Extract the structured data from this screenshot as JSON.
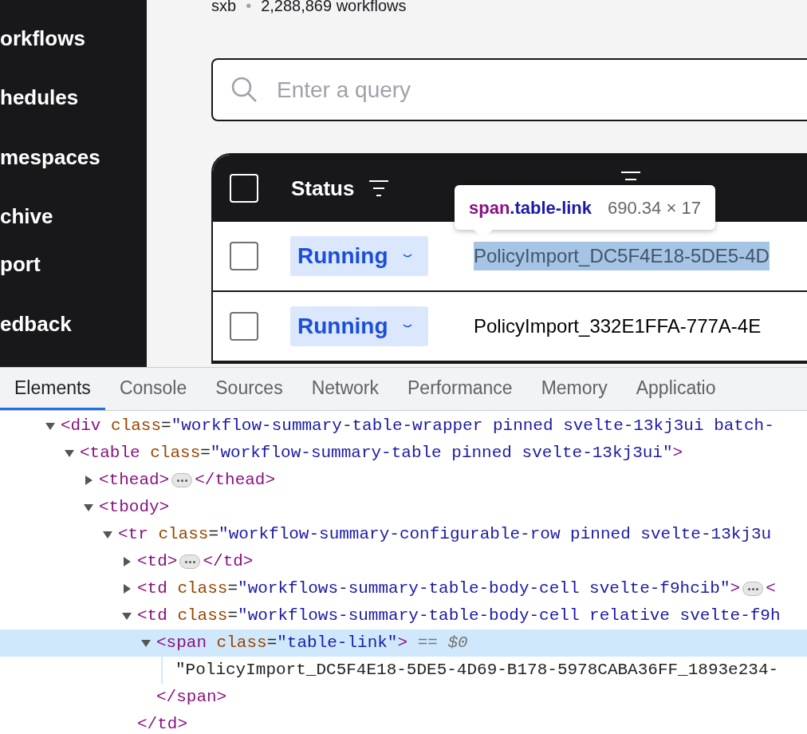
{
  "sidebar": {
    "items": [
      {
        "label": "orkflows"
      },
      {
        "label": "hedules"
      },
      {
        "label": "mespaces"
      },
      {
        "label": "chive"
      },
      {
        "label": "port"
      },
      {
        "label": "edback"
      }
    ]
  },
  "header": {
    "namespace": "sxb",
    "separator": "•",
    "count": "2,288,869 workflows"
  },
  "search": {
    "placeholder": "Enter a query"
  },
  "table": {
    "header": {
      "checked": false,
      "columns": [
        {
          "label": "Status",
          "filter": true
        },
        {
          "filter": true
        }
      ]
    },
    "rows": [
      {
        "checked": false,
        "status": "Running",
        "workflow_id": "PolicyImport_DC5F4E18-5DE5-4D",
        "inspected": true
      },
      {
        "checked": false,
        "status": "Running",
        "workflow_id": "PolicyImport_332E1FFA-777A-4E",
        "inspected": false
      }
    ]
  },
  "inspect_tooltip": {
    "tag": "span",
    "selector": ".table-link",
    "size": "690.34 × 17"
  },
  "devtools": {
    "tabs": [
      {
        "label": "Elements",
        "selected": true
      },
      {
        "label": "Console",
        "selected": false
      },
      {
        "label": "Sources",
        "selected": false
      },
      {
        "label": "Network",
        "selected": false
      },
      {
        "label": "Performance",
        "selected": false
      },
      {
        "label": "Memory",
        "selected": false
      },
      {
        "label": "Applicatio",
        "selected": false
      }
    ],
    "tree": [
      {
        "expanded": true,
        "selected": false,
        "tokens": [
          {
            "kind": "tag",
            "text": "<div"
          },
          {
            "kind": "attr",
            "text": " class"
          },
          {
            "kind": "punct",
            "text": "="
          },
          {
            "kind": "value",
            "text": "\"workflow-summary-table-wrapper pinned svelte-13kj3ui batch-"
          }
        ],
        "children": [
          {
            "expanded": true,
            "selected": false,
            "tokens": [
              {
                "kind": "tag",
                "text": "<table"
              },
              {
                "kind": "attr",
                "text": " class"
              },
              {
                "kind": "punct",
                "text": "="
              },
              {
                "kind": "value",
                "text": "\"workflow-summary-table pinned svelte-13kj3ui\""
              },
              {
                "kind": "tag",
                "text": ">"
              }
            ],
            "children": [
              {
                "expanded": false,
                "selected": false,
                "tokens": [
                  {
                    "kind": "tag",
                    "text": "<thead>"
                  },
                  {
                    "kind": "ellipsis"
                  },
                  {
                    "kind": "tag",
                    "text": "</thead>"
                  }
                ]
              },
              {
                "expanded": true,
                "selected": false,
                "tokens": [
                  {
                    "kind": "tag",
                    "text": "<tbody>"
                  }
                ],
                "children": [
                  {
                    "expanded": true,
                    "selected": false,
                    "tokens": [
                      {
                        "kind": "tag",
                        "text": "<tr"
                      },
                      {
                        "kind": "attr",
                        "text": " class"
                      },
                      {
                        "kind": "punct",
                        "text": "="
                      },
                      {
                        "kind": "value",
                        "text": "\"workflow-summary-configurable-row pinned svelte-13kj3u"
                      }
                    ],
                    "children": [
                      {
                        "expanded": false,
                        "selected": false,
                        "tokens": [
                          {
                            "kind": "tag",
                            "text": "<td>"
                          },
                          {
                            "kind": "ellipsis"
                          },
                          {
                            "kind": "tag",
                            "text": "</td>"
                          }
                        ]
                      },
                      {
                        "expanded": false,
                        "selected": false,
                        "tokens": [
                          {
                            "kind": "tag",
                            "text": "<td"
                          },
                          {
                            "kind": "attr",
                            "text": " class"
                          },
                          {
                            "kind": "punct",
                            "text": "="
                          },
                          {
                            "kind": "value",
                            "text": "\"workflows-summary-table-body-cell svelte-f9hcib\""
                          },
                          {
                            "kind": "tag",
                            "text": ">"
                          },
                          {
                            "kind": "ellipsis"
                          },
                          {
                            "kind": "tag",
                            "text": "<"
                          }
                        ]
                      },
                      {
                        "expanded": true,
                        "selected": false,
                        "tokens": [
                          {
                            "kind": "tag",
                            "text": "<td"
                          },
                          {
                            "kind": "attr",
                            "text": " class"
                          },
                          {
                            "kind": "punct",
                            "text": "="
                          },
                          {
                            "kind": "value",
                            "text": "\"workflows-summary-table-body-cell relative svelte-f9h"
                          }
                        ],
                        "children": [
                          {
                            "expanded": true,
                            "selected": true,
                            "tokens": [
                              {
                                "kind": "tag",
                                "text": "<span"
                              },
                              {
                                "kind": "attr",
                                "text": " class"
                              },
                              {
                                "kind": "punct",
                                "text": "="
                              },
                              {
                                "kind": "value",
                                "text": "\"table-link\""
                              },
                              {
                                "kind": "tag",
                                "text": ">"
                              },
                              {
                                "kind": "note",
                                "text": " == "
                              },
                              {
                                "kind": "note_italic",
                                "text": "$0"
                              }
                            ],
                            "children": [
                              {
                                "selected": false,
                                "tokens": [
                                  {
                                    "kind": "text",
                                    "text": "\"PolicyImport_DC5F4E18-5DE5-4D69-B178-5978CABA36FF_1893e234-"
                                  }
                                ]
                              }
                            ],
                            "close": [
                              {
                                "kind": "tag",
                                "text": "</span>"
                              }
                            ]
                          }
                        ],
                        "close": [
                          {
                            "kind": "tag",
                            "text": "</td>"
                          }
                        ]
                      }
                    ]
                  }
                ]
              }
            ]
          }
        ]
      }
    ]
  }
}
